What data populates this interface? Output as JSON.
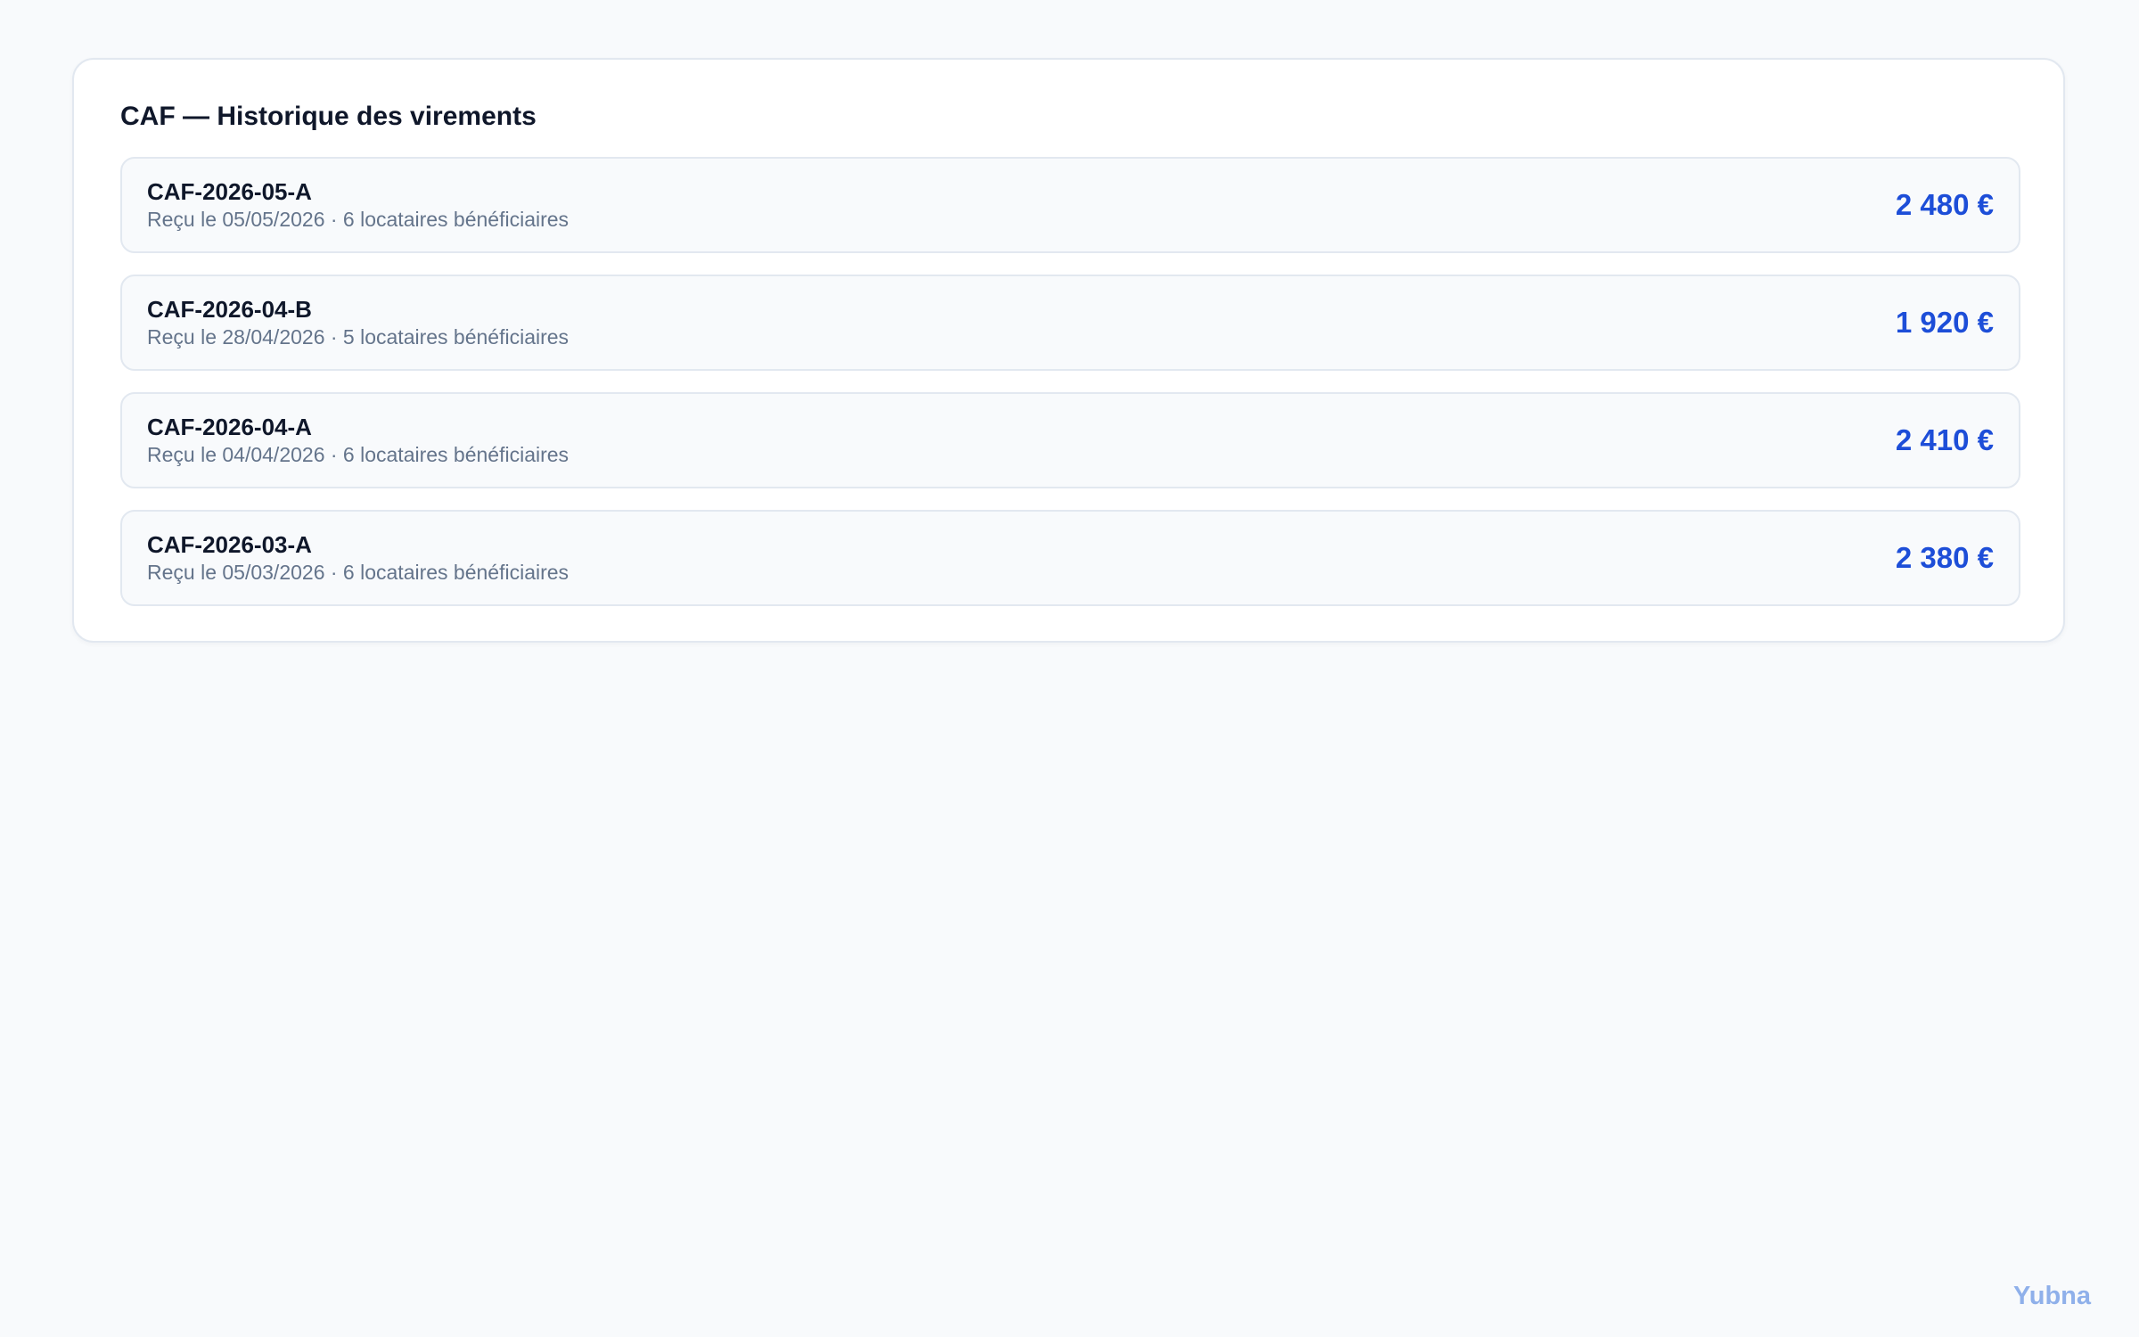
{
  "card": {
    "title": "CAF — Historique des virements"
  },
  "transfers": [
    {
      "reference": "CAF-2026-05-A",
      "details": "Reçu le 05/05/2026 · 6 locataires bénéficiaires",
      "amount": "2 480 €"
    },
    {
      "reference": "CAF-2026-04-B",
      "details": "Reçu le 28/04/2026 · 5 locataires bénéficiaires",
      "amount": "1 920 €"
    },
    {
      "reference": "CAF-2026-04-A",
      "details": "Reçu le 04/04/2026 · 6 locataires bénéficiaires",
      "amount": "2 410 €"
    },
    {
      "reference": "CAF-2026-03-A",
      "details": "Reçu le 05/03/2026 · 6 locataires bénéficiaires",
      "amount": "2 380 €"
    }
  ],
  "footer": {
    "brand": "Yubna"
  },
  "colors": {
    "accent": "#1d4ed8",
    "brand": "#8fb0ea",
    "background": "#f8fafc"
  }
}
